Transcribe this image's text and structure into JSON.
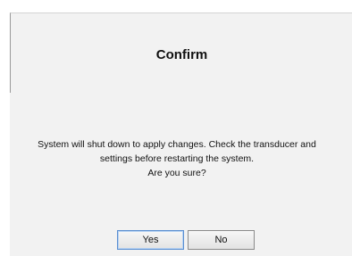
{
  "dialog": {
    "title": "Confirm",
    "message_lines": [
      "System will shut down to apply changes. Check the transducer and",
      "settings before restarting the system.",
      "Are you sure?"
    ],
    "buttons": {
      "yes_label": "Yes",
      "no_label": "No"
    }
  }
}
